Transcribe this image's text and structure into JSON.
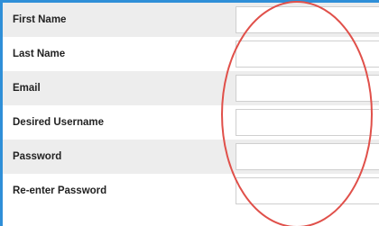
{
  "form": {
    "fields": [
      {
        "label": "First Name",
        "value": ""
      },
      {
        "label": "Last Name",
        "value": ""
      },
      {
        "label": "Email",
        "value": ""
      },
      {
        "label": "Desired Username",
        "value": ""
      },
      {
        "label": "Password",
        "value": ""
      },
      {
        "label": "Re-enter Password",
        "value": ""
      }
    ]
  },
  "colors": {
    "frame_border": "#2f8fd8",
    "row_shaded": "#ededed",
    "annotation_ring": "#e0504a"
  }
}
